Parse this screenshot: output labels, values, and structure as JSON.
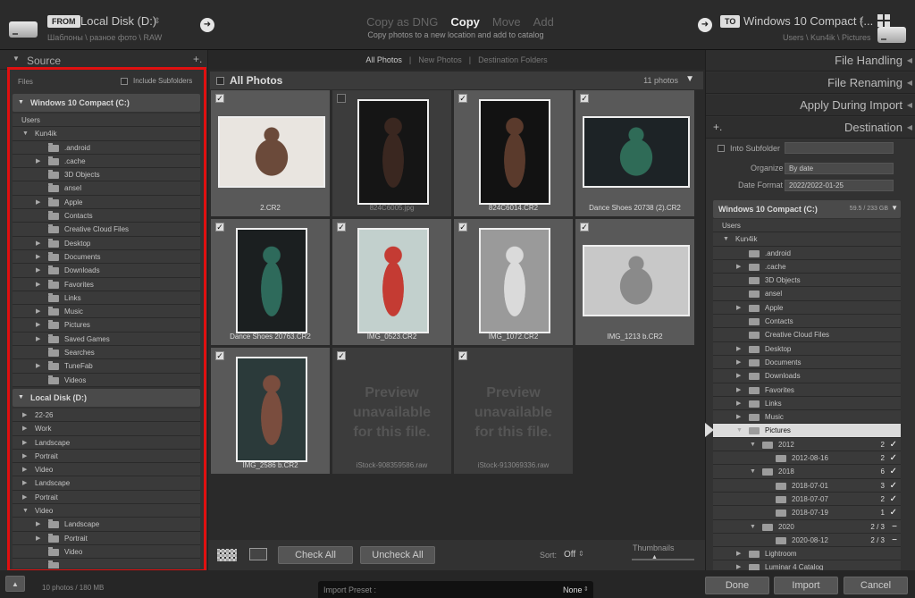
{
  "from": {
    "tag": "FROM",
    "name": "Local Disk (D:)",
    "path": "Шаблоны \\ разное фото \\ RAW"
  },
  "to": {
    "tag": "TO",
    "name": "Windows 10 Compact (...",
    "path": "Users \\ Kun4ik \\ Pictures"
  },
  "modes": [
    "Copy as DNG",
    "Copy",
    "Move",
    "Add"
  ],
  "mode_desc": "Copy photos to a new location and add to catalog",
  "source": {
    "title": "Source",
    "files_label": "Files",
    "include_subfolders": "Include Subfolders",
    "vol1": "Windows 10 Compact (C:)",
    "vol1_rows": [
      {
        "l": "Users",
        "d": 0,
        "t": ""
      },
      {
        "l": "Kun4ik",
        "d": 1,
        "t": "▼"
      },
      {
        "l": ".android",
        "d": 2,
        "t": ""
      },
      {
        "l": ".cache",
        "d": 2,
        "t": "▶"
      },
      {
        "l": "3D Objects",
        "d": 2,
        "t": ""
      },
      {
        "l": "ansel",
        "d": 2,
        "t": ""
      },
      {
        "l": "Apple",
        "d": 2,
        "t": "▶"
      },
      {
        "l": "Contacts",
        "d": 2,
        "t": ""
      },
      {
        "l": "Creative Cloud Files",
        "d": 2,
        "t": ""
      },
      {
        "l": "Desktop",
        "d": 2,
        "t": "▶"
      },
      {
        "l": "Documents",
        "d": 2,
        "t": "▶"
      },
      {
        "l": "Downloads",
        "d": 2,
        "t": "▶"
      },
      {
        "l": "Favorites",
        "d": 2,
        "t": "▶"
      },
      {
        "l": "Links",
        "d": 2,
        "t": ""
      },
      {
        "l": "Music",
        "d": 2,
        "t": "▶"
      },
      {
        "l": "Pictures",
        "d": 2,
        "t": "▶"
      },
      {
        "l": "Saved Games",
        "d": 2,
        "t": "▶"
      },
      {
        "l": "Searches",
        "d": 2,
        "t": ""
      },
      {
        "l": "TuneFab",
        "d": 2,
        "t": "▶"
      },
      {
        "l": "Videos",
        "d": 2,
        "t": ""
      }
    ],
    "vol2": "Local Disk (D:)",
    "vol2_rows": [
      {
        "l": "22-26",
        "d": 1,
        "t": "▶"
      },
      {
        "l": "Work",
        "d": 1,
        "t": "▶"
      },
      {
        "l": "Landscape",
        "d": 1,
        "t": "▶"
      },
      {
        "l": "Portrait",
        "d": 1,
        "t": "▶"
      },
      {
        "l": "Video",
        "d": 1,
        "t": "▶"
      },
      {
        "l": "Landscape",
        "d": 1,
        "t": "▶"
      },
      {
        "l": "Portrait",
        "d": 1,
        "t": "▶"
      },
      {
        "l": "Video",
        "d": 1,
        "t": "▼"
      },
      {
        "l": "Landscape",
        "d": 2,
        "t": "▶"
      },
      {
        "l": "Portrait",
        "d": 2,
        "t": "▶"
      },
      {
        "l": "Video",
        "d": 2,
        "t": ""
      },
      {
        "l": "",
        "d": 2,
        "t": ""
      }
    ]
  },
  "tabs": [
    "All Photos",
    "New Photos",
    "Destination Folders"
  ],
  "grid": {
    "title": "All Photos",
    "count": "11 photos",
    "preview_text": [
      "Preview",
      "unavailable",
      "for this file."
    ],
    "cells": [
      {
        "name": "2.CR2",
        "checked": true,
        "sel": true,
        "tw": 120,
        "th": 80,
        "bg": "#e9e5e0",
        "fig": "#6b4a3a",
        "prev": false
      },
      {
        "name": "824C6005.jpg",
        "checked": false,
        "sel": false,
        "tw": 80,
        "th": 118,
        "bg": "#151515",
        "fig": "#3a2720",
        "prev": false
      },
      {
        "name": "824C6014.CR2",
        "checked": true,
        "sel": true,
        "tw": 80,
        "th": 118,
        "bg": "#121212",
        "fig": "#5a3a2c",
        "prev": false
      },
      {
        "name": "Dance Shoes 20738 (2).CR2",
        "checked": true,
        "sel": true,
        "tw": 120,
        "th": 80,
        "bg": "#1d2326",
        "fig": "#2f6b57",
        "prev": false
      },
      {
        "name": "Dance Shoes 20763.CR2",
        "checked": true,
        "sel": true,
        "tw": 80,
        "th": 118,
        "bg": "#1b1f20",
        "fig": "#2e6a5b",
        "prev": false
      },
      {
        "name": "IMG_0523.CR2",
        "checked": true,
        "sel": true,
        "tw": 80,
        "th": 118,
        "bg": "#c2d0cd",
        "fig": "#c43b33",
        "prev": false
      },
      {
        "name": "IMG_1072.CR2",
        "checked": true,
        "sel": true,
        "tw": 80,
        "th": 118,
        "bg": "#9a9a9a",
        "fig": "#dadada",
        "prev": false
      },
      {
        "name": "IMG_1213 b.CR2",
        "checked": true,
        "sel": true,
        "tw": 120,
        "th": 80,
        "bg": "#c8c8c8",
        "fig": "#8a8a8a",
        "prev": false
      },
      {
        "name": "IMG_2586 b.CR2",
        "checked": true,
        "sel": true,
        "tw": 80,
        "th": 118,
        "bg": "#2b3a3a",
        "fig": "#7a4d3e",
        "prev": false
      },
      {
        "name": "iStock-908359586.raw",
        "checked": true,
        "sel": false,
        "tw": 0,
        "th": 0,
        "bg": "",
        "fig": "",
        "prev": true
      },
      {
        "name": "iStock-913069336.raw",
        "checked": true,
        "sel": false,
        "tw": 0,
        "th": 0,
        "bg": "",
        "fig": "",
        "prev": true
      }
    ]
  },
  "toolbar": {
    "check_all": "Check All",
    "uncheck_all": "Uncheck All",
    "sort_label": "Sort:",
    "sort_value": "Off",
    "thumbnails": "Thumbnails"
  },
  "right": {
    "sections": [
      "File Handling",
      "File Renaming",
      "Apply During Import",
      "Destination"
    ],
    "into_subfolder": "Into Subfolder",
    "organize_label": "Organize",
    "organize_value": "By date",
    "date_format_label": "Date Format",
    "date_format_value": "2022/2022-01-25",
    "vol": "Windows 10 Compact (C:)",
    "vol_size": "59.5 / 233 GB",
    "rows": [
      {
        "l": "Users",
        "d": 0,
        "t": "",
        "c": "",
        "k": "",
        "hl": false
      },
      {
        "l": "Kun4ik",
        "d": 1,
        "t": "▼",
        "c": "",
        "k": "",
        "hl": false
      },
      {
        "l": ".android",
        "d": 2,
        "t": "",
        "c": "",
        "k": "",
        "hl": false
      },
      {
        "l": ".cache",
        "d": 2,
        "t": "▶",
        "c": "",
        "k": "",
        "hl": false
      },
      {
        "l": "3D Objects",
        "d": 2,
        "t": "",
        "c": "",
        "k": "",
        "hl": false
      },
      {
        "l": "ansel",
        "d": 2,
        "t": "",
        "c": "",
        "k": "",
        "hl": false
      },
      {
        "l": "Apple",
        "d": 2,
        "t": "▶",
        "c": "",
        "k": "",
        "hl": false
      },
      {
        "l": "Contacts",
        "d": 2,
        "t": "",
        "c": "",
        "k": "",
        "hl": false
      },
      {
        "l": "Creative Cloud Files",
        "d": 2,
        "t": "",
        "c": "",
        "k": "",
        "hl": false
      },
      {
        "l": "Desktop",
        "d": 2,
        "t": "▶",
        "c": "",
        "k": "",
        "hl": false
      },
      {
        "l": "Documents",
        "d": 2,
        "t": "▶",
        "c": "",
        "k": "",
        "hl": false
      },
      {
        "l": "Downloads",
        "d": 2,
        "t": "▶",
        "c": "",
        "k": "",
        "hl": false
      },
      {
        "l": "Favorites",
        "d": 2,
        "t": "▶",
        "c": "",
        "k": "",
        "hl": false
      },
      {
        "l": "Links",
        "d": 2,
        "t": "▶",
        "c": "",
        "k": "",
        "hl": false
      },
      {
        "l": "Music",
        "d": 2,
        "t": "▶",
        "c": "",
        "k": "",
        "hl": false
      },
      {
        "l": "Pictures",
        "d": 2,
        "t": "▼",
        "c": "",
        "k": "",
        "hl": true
      },
      {
        "l": "2012",
        "d": 3,
        "t": "▼",
        "c": "2",
        "k": "✓",
        "hl": false
      },
      {
        "l": "2012-08-16",
        "d": 4,
        "t": "",
        "c": "2",
        "k": "✓",
        "hl": false
      },
      {
        "l": "2018",
        "d": 3,
        "t": "▼",
        "c": "6",
        "k": "✓",
        "hl": false
      },
      {
        "l": "2018-07-01",
        "d": 4,
        "t": "",
        "c": "3",
        "k": "✓",
        "hl": false
      },
      {
        "l": "2018-07-07",
        "d": 4,
        "t": "",
        "c": "2",
        "k": "✓",
        "hl": false
      },
      {
        "l": "2018-07-19",
        "d": 4,
        "t": "",
        "c": "1",
        "k": "✓",
        "hl": false
      },
      {
        "l": "2020",
        "d": 3,
        "t": "▼",
        "c": "2 / 3",
        "k": "−",
        "hl": false
      },
      {
        "l": "2020-08-12",
        "d": 4,
        "t": "",
        "c": "2 / 3",
        "k": "−",
        "hl": false
      },
      {
        "l": "Lightroom",
        "d": 2,
        "t": "▶",
        "c": "",
        "k": "",
        "hl": false
      },
      {
        "l": "Luminar 4 Catalog",
        "d": 2,
        "t": "▶",
        "c": "",
        "k": "",
        "hl": false
      }
    ]
  },
  "bottom": {
    "status": "10 photos / 180 MB",
    "import_preset_label": "Import Preset :",
    "import_preset_value": "None",
    "done": "Done",
    "import": "Import",
    "cancel": "Cancel"
  }
}
